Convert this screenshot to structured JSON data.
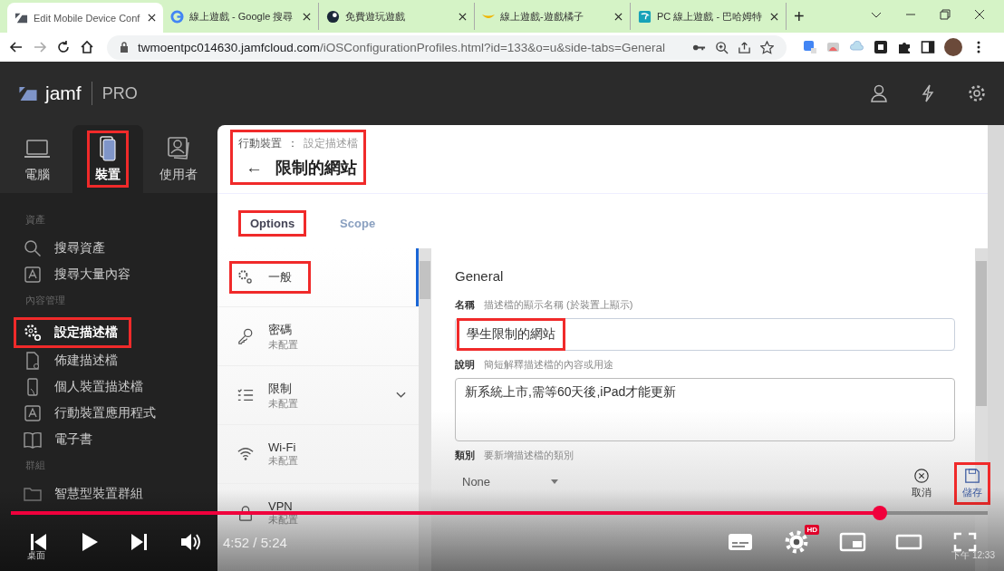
{
  "browser": {
    "tabs": [
      {
        "title": "Edit Mobile Device Conf",
        "selected": true
      },
      {
        "title": "線上遊戲 - Google 搜尋",
        "selected": false
      },
      {
        "title": "免費遊玩遊戲",
        "selected": false
      },
      {
        "title": "線上遊戲-遊戲橘子",
        "selected": false
      },
      {
        "title": "PC 線上遊戲 - 巴哈姆特",
        "selected": false
      }
    ],
    "new_tab": "+",
    "url": {
      "host": "twmoentpc014630.jamfcloud.com",
      "path": "/iOSConfigurationProfiles.html?id=133&o=u&side-tabs=General"
    }
  },
  "app": {
    "brand": "jamf",
    "product": "PRO",
    "nav_tabs": [
      {
        "label": "電腦",
        "selected": false,
        "highlighted": false
      },
      {
        "label": "裝置",
        "selected": true,
        "highlighted": true
      },
      {
        "label": "使用者",
        "selected": false,
        "highlighted": false
      }
    ],
    "sidebar": [
      {
        "heading": "資產",
        "items": [
          {
            "label": "搜尋資產",
            "highlighted": false
          },
          {
            "label": "搜尋大量內容",
            "highlighted": false
          }
        ]
      },
      {
        "heading": "內容管理",
        "items": [
          {
            "label": "設定描述檔",
            "highlighted": true
          },
          {
            "label": "佈建描述檔",
            "highlighted": false
          },
          {
            "label": "個人裝置描述檔",
            "highlighted": false
          },
          {
            "label": "行動裝置應用程式",
            "highlighted": false
          },
          {
            "label": "電子書",
            "highlighted": false
          }
        ]
      },
      {
        "heading": "群組",
        "items": [
          {
            "label": "智慧型裝置群組",
            "highlighted": false
          }
        ]
      }
    ]
  },
  "page": {
    "breadcrumb": [
      "行動裝置",
      "設定描述檔"
    ],
    "separator": "：",
    "back": "←",
    "title": "限制的網站",
    "title_highlighted": true,
    "tabs": [
      {
        "label": "Options",
        "selected": true,
        "highlighted": true
      },
      {
        "label": "Scope",
        "selected": false,
        "highlighted": false
      }
    ],
    "payloads": [
      {
        "label": "一般",
        "selected": true,
        "highlighted": true,
        "expandable": false
      },
      {
        "label": "密碼",
        "status": "未配置",
        "selected": false,
        "highlighted": false,
        "expandable": false
      },
      {
        "label": "限制",
        "status": "未配置",
        "selected": false,
        "highlighted": false,
        "expandable": true
      },
      {
        "label": "Wi-Fi",
        "status": "未配置",
        "selected": false,
        "highlighted": false,
        "expandable": false
      },
      {
        "label": "VPN",
        "status": "未配置",
        "selected": false,
        "highlighted": false,
        "expandable": false
      }
    ],
    "section": "General",
    "fields": [
      {
        "kind": "text",
        "label": "名稱",
        "hint": "描述檔的顯示名稱 (於裝置上顯示)",
        "value": "學生限制的網站",
        "highlighted": true
      },
      {
        "kind": "textarea",
        "label": "說明",
        "hint": "簡短解釋描述檔的內容或用途",
        "value": "新系統上市,需等60天後,iPad才能更新",
        "highlighted": false
      },
      {
        "kind": "select",
        "label": "類別",
        "hint": "要新增描述檔的類別",
        "value": "None",
        "highlighted": false
      }
    ],
    "actions": [
      {
        "kind": "cancel",
        "label": "取消",
        "highlighted": false
      },
      {
        "kind": "save",
        "label": "儲存",
        "highlighted": true
      }
    ]
  },
  "player": {
    "level": 0.89,
    "time": "4:52 / 5:24",
    "badge": "HD"
  },
  "desktop": {
    "folder": "桌面",
    "clock": "下午 12:33"
  }
}
